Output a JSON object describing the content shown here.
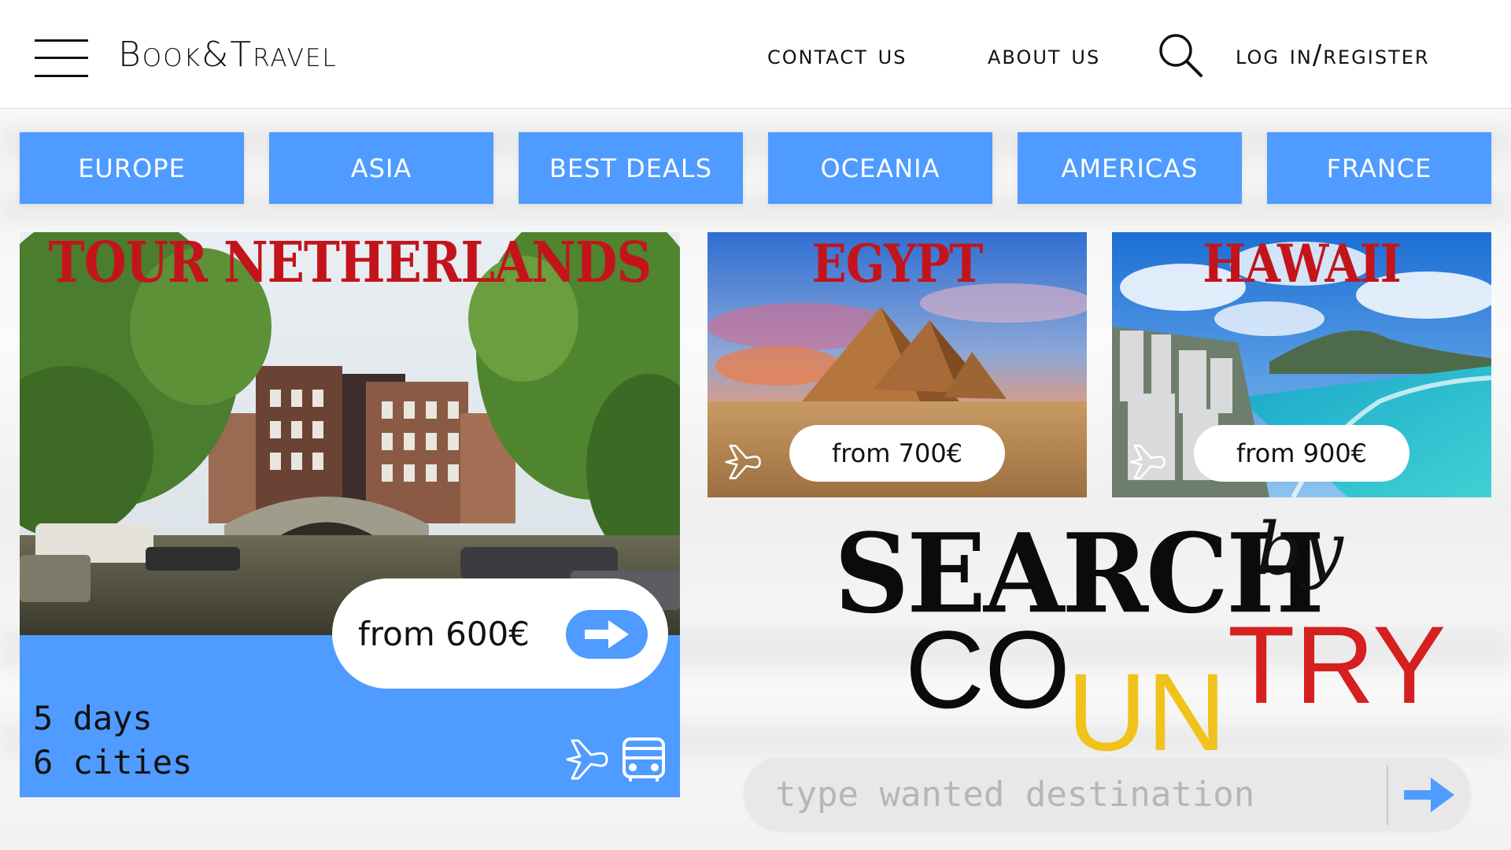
{
  "header": {
    "brand": "Book&Travel",
    "nav": {
      "contact": "CONTACT US",
      "about": "ABOUT US",
      "login": "LOG IN/REGISTER"
    }
  },
  "categories": [
    "EUROPE",
    "ASIA",
    "BEST DEALS",
    "OCEANIA",
    "AMERICAS",
    "FRANCE"
  ],
  "featured": {
    "title": "TOUR NETHERLANDS",
    "price": "from 600€",
    "days": "5 days",
    "cities": "6 cities"
  },
  "cards": [
    {
      "title": "EGYPT",
      "price": "from 700€"
    },
    {
      "title": "HAWAII",
      "price": "from 900€"
    }
  ],
  "search_section": {
    "title": "SEARCH",
    "by": "by",
    "country_parts": [
      "CO",
      "UN",
      "TRY"
    ],
    "placeholder": "type wanted destination"
  },
  "colors": {
    "accent": "#4f9bff",
    "title_red": "#c3141c",
    "country_black": "#0b0b0b",
    "country_yellow": "#f1c21b",
    "country_red": "#d61f1f"
  }
}
